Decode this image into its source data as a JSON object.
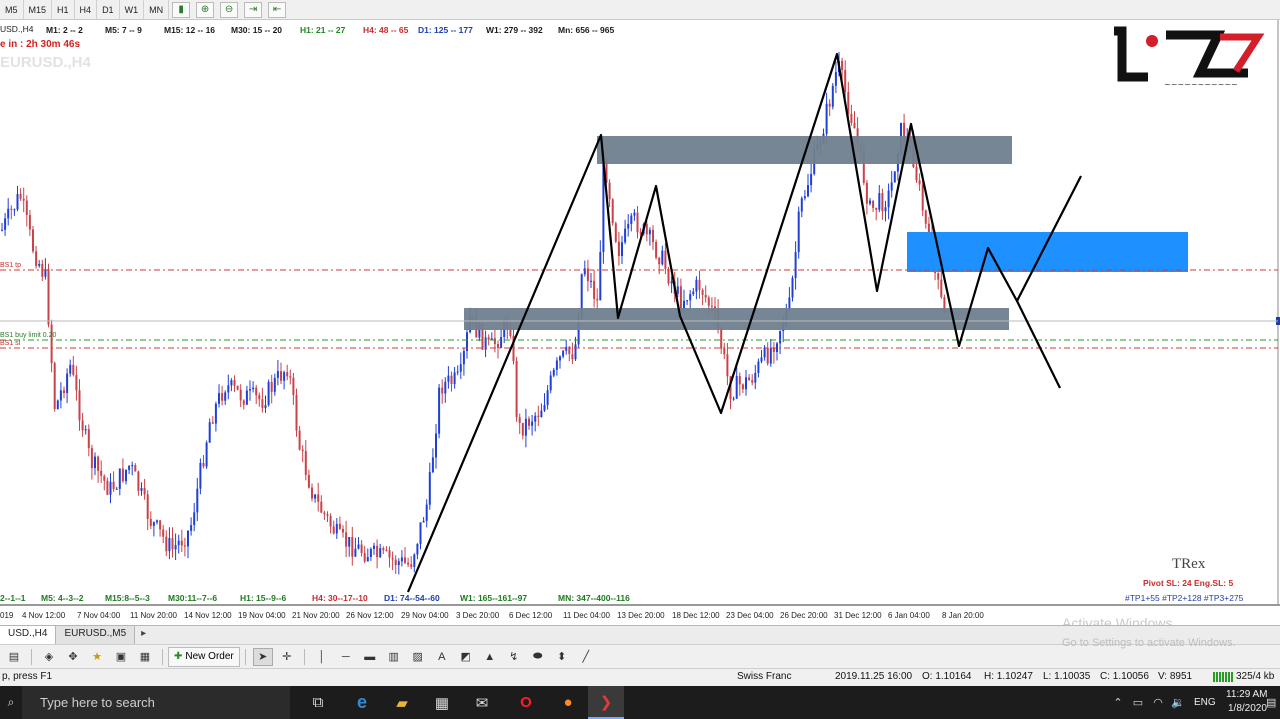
{
  "toolbar": {
    "timeframes": [
      "M5",
      "M15",
      "H1",
      "H4",
      "D1",
      "W1",
      "MN"
    ]
  },
  "chart": {
    "symbol_label": "USD.,H4",
    "next_bar": "e in : 2h 30m 46s",
    "watermark": "EURUSD.,H4",
    "top_counts": [
      {
        "text": "M1: 2 -- 2",
        "color": "#1a1a1a"
      },
      {
        "text": "M5: 7 -- 9",
        "color": "#1a1a1a"
      },
      {
        "text": "M15: 12 -- 16",
        "color": "#1a1a1a"
      },
      {
        "text": "M30: 15 -- 20",
        "color": "#1a1a1a"
      },
      {
        "text": "H1: 21 -- 27",
        "color": "#1d8a1d"
      },
      {
        "text": "H4: 48 -- 65",
        "color": "#cc2b2b"
      },
      {
        "text": "D1: 125 -- 177",
        "color": "#1e3fa8"
      },
      {
        "text": "W1: 279 -- 392",
        "color": "#1a1a1a"
      },
      {
        "text": "Mn: 656 -- 965",
        "color": "#1a1a1a"
      }
    ],
    "bottom_counts": [
      {
        "text": "2--1--1",
        "color": "#1e7a1e"
      },
      {
        "text": "M5: 4--3--2",
        "color": "#1e7a1e"
      },
      {
        "text": "M15:8--5--3",
        "color": "#1e7a1e"
      },
      {
        "text": "M30:11--7--6",
        "color": "#1e7a1e"
      },
      {
        "text": "H1: 15--9--6",
        "color": "#1e7a1e"
      },
      {
        "text": "H4: 30--17--10",
        "color": "#cc2b2b"
      },
      {
        "text": "D1: 74--54--60",
        "color": "#1e3fa8"
      },
      {
        "text": "W1: 165--161--97",
        "color": "#1e7a1e"
      },
      {
        "text": "MN: 347--400--116",
        "color": "#1e7a1e"
      }
    ],
    "line_labels": {
      "tp": "BS1 tp",
      "limit": "BS1 buy limit 0.20",
      "sl": "BS1 sl"
    },
    "dates": [
      "019",
      "4 Nov 12:00",
      "7 Nov 04:00",
      "11 Nov 20:00",
      "14 Nov 12:00",
      "19 Nov 04:00",
      "21 Nov 20:00",
      "26 Nov 12:00",
      "29 Nov 04:00",
      "3 Dec 20:00",
      "6 Dec 12:00",
      "11 Dec 04:00",
      "13 Dec 20:00",
      "18 Dec 12:00",
      "23 Dec 04:00",
      "26 Dec 20:00",
      "31 Dec 12:00",
      "6 Jan 04:00",
      "8 Jan 20:00"
    ],
    "trex": {
      "title": "TRex",
      "pivot": "Pivot SL: 24  Eng.SL: 5",
      "targets": "#TP1+55    #TP2+128    #TP3+275"
    },
    "activation": {
      "title": "Activate Windows",
      "subtitle": "Go to Settings to activate Windows."
    },
    "colors": {
      "bull": "#1f3fd6",
      "bear": "#c9424a",
      "zone_gray": "#707f8e",
      "zone_blue": "#1e90ff",
      "tp_line": "#d63a3a",
      "sl_line": "#d63a3a",
      "limit_line": "#2a9a2a"
    }
  },
  "tabs": [
    "USD.,H4",
    "EURUSD.,M5"
  ],
  "tools": {
    "new_order": "New Order"
  },
  "status": {
    "help": "p, press F1",
    "instrument": "Swiss Franc",
    "datetime": "2019.11.25 16:00",
    "open": "O: 1.10164",
    "high": "H: 1.10247",
    "low": "L: 1.10035",
    "close": "C: 1.10056",
    "volume": "V: 8951",
    "traffic": "325/4 kb"
  },
  "taskbar": {
    "search_placeholder": "Type here to search",
    "lang": "ENG",
    "time": "11:29 AM",
    "date": "1/8/2020"
  }
}
